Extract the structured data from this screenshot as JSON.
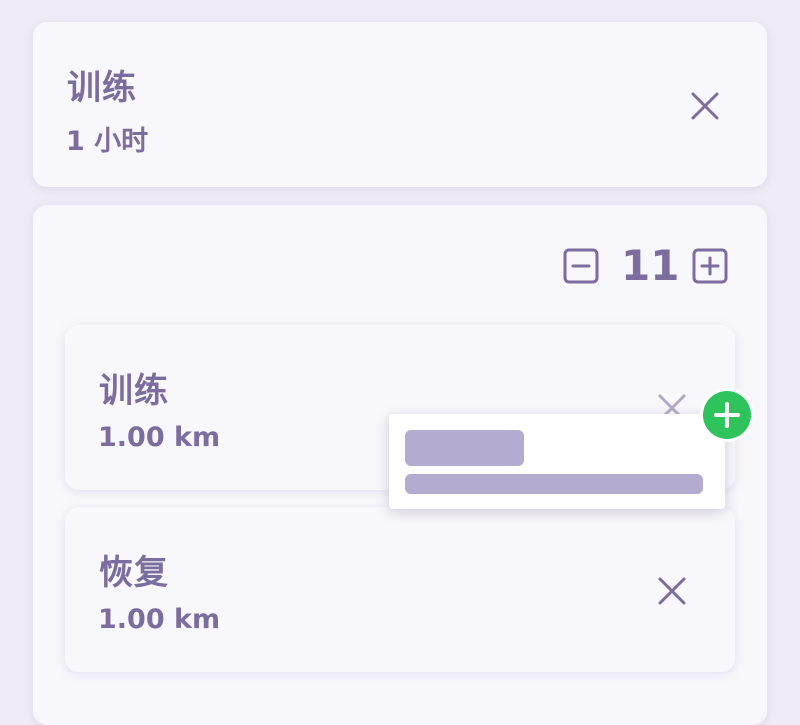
{
  "cards": [
    {
      "title": "训练",
      "subtitle": "1 小时"
    },
    {
      "title": "训练",
      "subtitle": "1.00 km"
    },
    {
      "title": "恢复",
      "subtitle": "1.00 km"
    }
  ],
  "repeat_group": {
    "count": "11"
  },
  "colors": {
    "background": "#efecf5",
    "card": "#f8f7fb",
    "text": "#7b6d9d",
    "placeholder": "#b3abd0",
    "add_badge": "#2ec35b"
  },
  "icons": {
    "close": "close-icon",
    "minus": "minus-square-icon",
    "plus": "plus-square-icon",
    "add": "plus-circle-icon"
  }
}
